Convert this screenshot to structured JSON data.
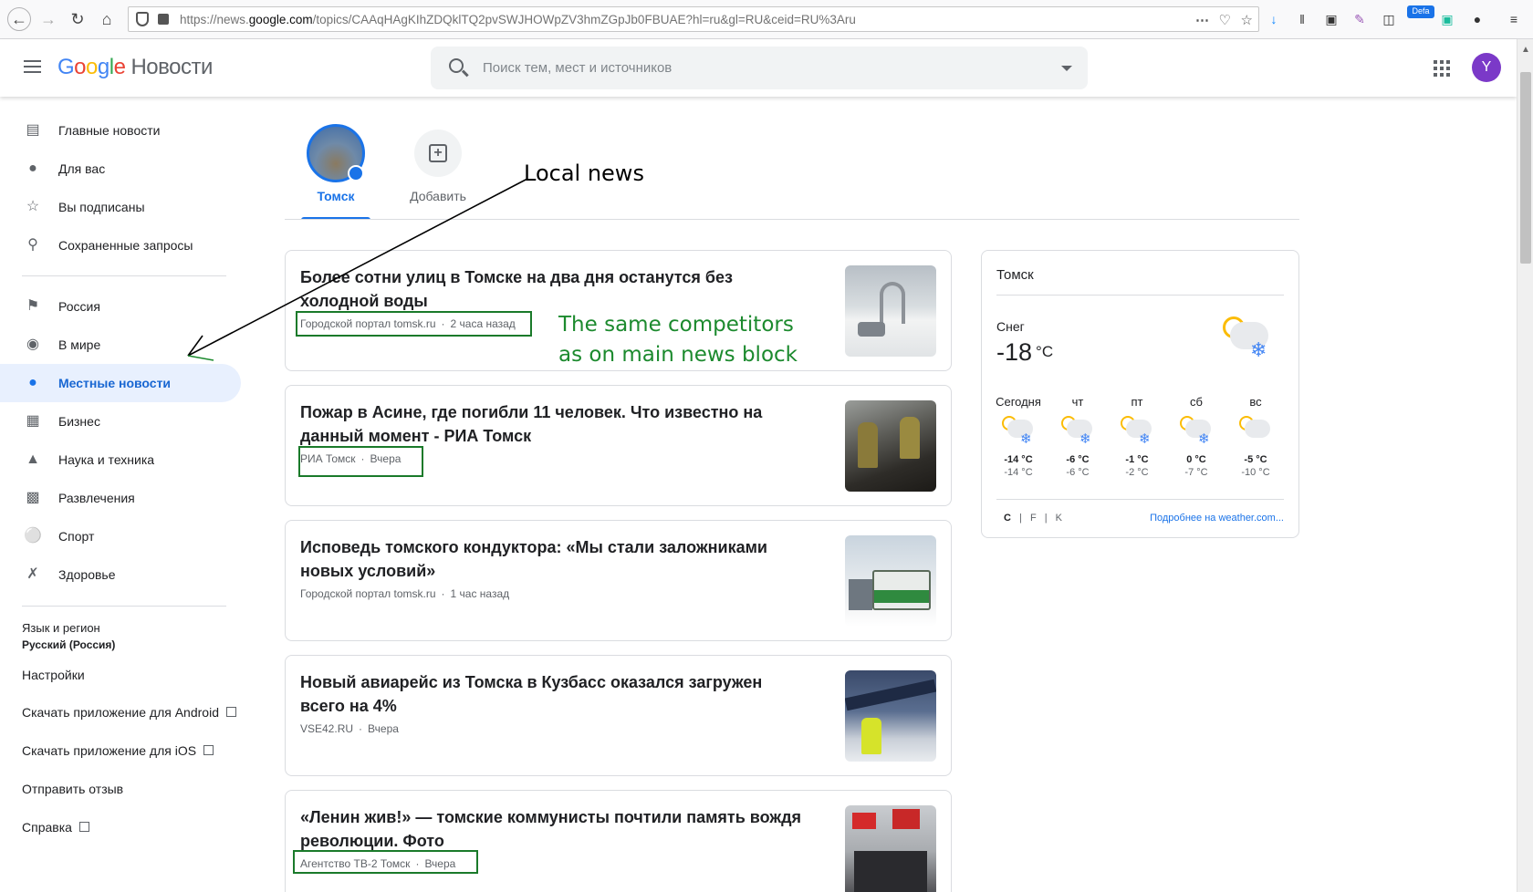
{
  "browser": {
    "url_prefix": "https://news.",
    "url_domain": "google.com",
    "url_path": "/topics/CAAqHAgKIhZDQklTQ2pvSWJHOWpZV3hmZGpJb0FBUAE?hl=ru&gl=RU&ceid=RU%3Aru",
    "defa_badge": "Defa"
  },
  "header": {
    "logo_letters": [
      "G",
      "o",
      "o",
      "g",
      "l",
      "e"
    ],
    "product": "Новости",
    "search_placeholder": "Поиск тем, мест и источников",
    "avatar_letter": "Y"
  },
  "sidebar": {
    "items": [
      {
        "label": "Главные новости",
        "icon": "newspaper-icon"
      },
      {
        "label": "Для вас",
        "icon": "person-icon"
      },
      {
        "label": "Вы подписаны",
        "icon": "star-icon"
      },
      {
        "label": "Сохраненные запросы",
        "icon": "search-icon"
      }
    ],
    "sections": [
      {
        "label": "Россия",
        "icon": "flag-icon"
      },
      {
        "label": "В мире",
        "icon": "globe-icon"
      },
      {
        "label": "Местные новости",
        "icon": "pin-icon",
        "active": true
      },
      {
        "label": "Бизнес",
        "icon": "building-icon"
      },
      {
        "label": "Наука и техника",
        "icon": "flask-icon"
      },
      {
        "label": "Развлечения",
        "icon": "film-icon"
      },
      {
        "label": "Спорт",
        "icon": "bike-icon"
      },
      {
        "label": "Здоровье",
        "icon": "dumbbell-icon"
      }
    ],
    "lang_title": "Язык и регион",
    "lang_value": "Русский (Россия)",
    "settings": "Настройки",
    "android": "Скачать приложение для Android",
    "ios": "Скачать приложение для iOS",
    "feedback": "Отправить отзыв",
    "help": "Справка"
  },
  "topics": [
    {
      "label": "Томск"
    },
    {
      "label": "Добавить"
    }
  ],
  "articles": [
    {
      "title": "Более сотни улиц в Томске на два дня останутся без холодной воды",
      "source": "Городской портал tomsk.ru",
      "time": "2 часа назад",
      "thumb": "faucet"
    },
    {
      "title": "Пожар в Асине, где погибли 11 человек. Что известно на данный момент - РИА Томск",
      "source": "РИА Томск",
      "time": "Вчера",
      "thumb": "fire"
    },
    {
      "title": "Исповедь томского кондуктора: «Мы стали заложниками новых условий»",
      "source": "Городской портал tomsk.ru",
      "time": "1 час назад",
      "thumb": "bus"
    },
    {
      "title": "Новый авиарейс из Томска в Кузбасс оказался загружен всего на 4%",
      "source": "VSE42.RU",
      "time": "Вчера",
      "thumb": "plane"
    },
    {
      "title": "«Ленин жив!» — томские коммунисты почтили память вождя революции. Фото",
      "source": "Агентство ТВ-2 Томск",
      "time": "Вчера",
      "thumb": "flags"
    }
  ],
  "weather": {
    "city": "Томск",
    "condition": "Снег",
    "temp": "-18",
    "unit": "°C",
    "days": [
      {
        "name": "Сегодня",
        "hi": "-14 °C",
        "lo": "-14 °C"
      },
      {
        "name": "чт",
        "hi": "-6 °C",
        "lo": "-6 °C"
      },
      {
        "name": "пт",
        "hi": "-1 °C",
        "lo": "-2 °C"
      },
      {
        "name": "сб",
        "hi": "0 °C",
        "lo": "-7 °C"
      },
      {
        "name": "вс",
        "hi": "-5 °C",
        "lo": "-10 °C"
      }
    ],
    "units_c": "C",
    "units_f": "F",
    "units_k": "K",
    "more": "Подробнее на weather.com..."
  },
  "annotations": {
    "local_news": "Local news",
    "competitors_line1": "The same competitors",
    "competitors_line2": "as on main news block"
  }
}
